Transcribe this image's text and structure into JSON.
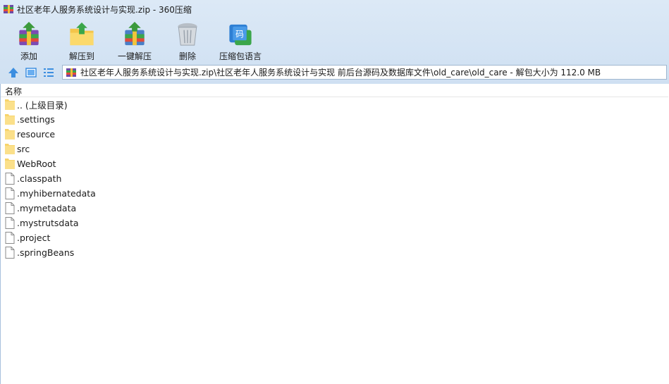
{
  "window": {
    "title": "社区老年人服务系统设计与实现.zip - 360压缩",
    "icon": "archive-icon"
  },
  "toolbar": {
    "items": [
      {
        "label": "添加",
        "icon": "add-archive-icon"
      },
      {
        "label": "解压到",
        "icon": "extract-to-icon"
      },
      {
        "label": "一键解压",
        "icon": "one-click-extract-icon"
      },
      {
        "label": "删除",
        "icon": "trash-icon"
      },
      {
        "label": "压缩包语言",
        "icon": "archive-language-icon"
      }
    ]
  },
  "addressbar": {
    "path": "社区老年人服务系统设计与实现.zip\\社区老年人服务系统设计与实现 前后台源码及数据库文件\\old_care\\old_care - 解包大小为 112.0 MB"
  },
  "filelist": {
    "column_name": "名称",
    "items": [
      {
        "name": ".. (上级目录)",
        "type": "folder"
      },
      {
        "name": ".settings",
        "type": "folder"
      },
      {
        "name": "resource",
        "type": "folder"
      },
      {
        "name": "src",
        "type": "folder"
      },
      {
        "name": "WebRoot",
        "type": "folder"
      },
      {
        "name": ".classpath",
        "type": "file"
      },
      {
        "name": ".myhibernatedata",
        "type": "file"
      },
      {
        "name": ".mymetadata",
        "type": "file"
      },
      {
        "name": ".mystrutsdata",
        "type": "file"
      },
      {
        "name": ".project",
        "type": "file"
      },
      {
        "name": ".springBeans",
        "type": "file"
      }
    ]
  },
  "colors": {
    "chrome_bg": "#dce9f6",
    "folder": "#f7d46b",
    "accent_blue": "#3c8ee0"
  }
}
